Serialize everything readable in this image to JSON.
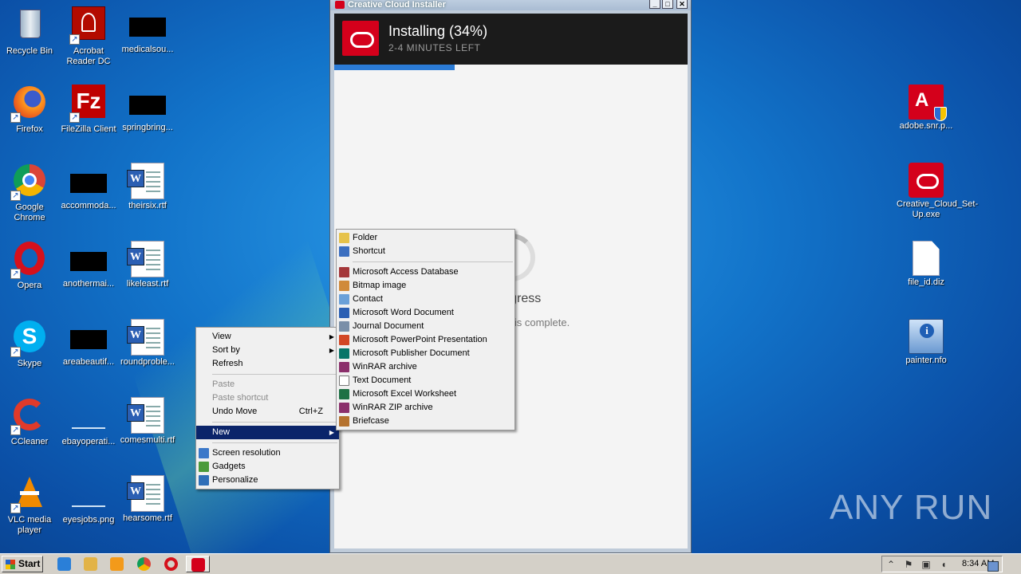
{
  "desktop_icons_left": [
    {
      "label": "Recycle Bin",
      "icon": "recycle-bin-icon"
    },
    {
      "label": "Acrobat Reader DC",
      "icon": "acrobat-icon"
    },
    {
      "label": "medicalsou...",
      "icon": "redacted-icon"
    },
    {
      "label": "Firefox",
      "icon": "firefox-icon"
    },
    {
      "label": "FileZilla Client",
      "icon": "filezilla-icon"
    },
    {
      "label": "springbring...",
      "icon": "redacted-icon"
    },
    {
      "label": "Google Chrome",
      "icon": "chrome-icon"
    },
    {
      "label": "accommoda...",
      "icon": "redacted-icon"
    },
    {
      "label": "theirsix.rtf",
      "icon": "word-doc-icon"
    },
    {
      "label": "Opera",
      "icon": "opera-icon"
    },
    {
      "label": "anothermai...",
      "icon": "redacted-icon"
    },
    {
      "label": "likeleast.rtf",
      "icon": "word-doc-icon"
    },
    {
      "label": "Skype",
      "icon": "skype-icon"
    },
    {
      "label": "areabeautif...",
      "icon": "redacted-icon"
    },
    {
      "label": "roundproble...",
      "icon": "word-doc-icon"
    },
    {
      "label": "CCleaner",
      "icon": "ccleaner-icon"
    },
    {
      "label": "ebayoperati...",
      "icon": "blank-icon"
    },
    {
      "label": "comesmulti.rtf",
      "icon": "word-doc-icon"
    },
    {
      "label": "VLC media player",
      "icon": "vlc-icon"
    },
    {
      "label": "eyesjobs.png",
      "icon": "image-icon"
    },
    {
      "label": "hearsome.rtf",
      "icon": "word-doc-icon"
    }
  ],
  "desktop_icons_right": [
    {
      "label": "adobe.snr.p...",
      "icon": "adobe-installer-icon"
    },
    {
      "label": "Creative_Cloud_Set-Up.exe",
      "icon": "creative-cloud-icon"
    },
    {
      "label": "file_id.diz",
      "icon": "blank-file-icon"
    },
    {
      "label": "painter.nfo",
      "icon": "info-file-icon"
    }
  ],
  "installer": {
    "window_title": "Creative Cloud Installer",
    "status_title": "Installing (34%)",
    "status_subtitle": "2-4 MINUTES LEFT",
    "progress_fraction": 0.34,
    "body_title": "n progress",
    "body_subtitle": "til installation is complete."
  },
  "context_menu": {
    "items": [
      {
        "label": "View",
        "submenu": true
      },
      {
        "label": "Sort by",
        "submenu": true
      },
      {
        "label": "Refresh"
      },
      {
        "label": "Paste",
        "disabled": true
      },
      {
        "label": "Paste shortcut",
        "disabled": true
      },
      {
        "label": "Undo Move",
        "shortcut": "Ctrl+Z"
      },
      {
        "label": "New",
        "submenu": true,
        "active": true
      },
      {
        "label": "Screen resolution"
      },
      {
        "label": "Gadgets"
      },
      {
        "label": "Personalize"
      }
    ]
  },
  "new_submenu": {
    "items": [
      {
        "label": "Folder",
        "color": "#e6c24a"
      },
      {
        "label": "Shortcut",
        "color": "#3b6fc0"
      },
      {
        "label": "Microsoft Access Database",
        "color": "#a4373a"
      },
      {
        "label": "Bitmap image",
        "color": "#d08a3a"
      },
      {
        "label": "Contact",
        "color": "#6aa0d8"
      },
      {
        "label": "Microsoft Word Document",
        "color": "#2b5fb3"
      },
      {
        "label": "Journal Document",
        "color": "#7a8fa8"
      },
      {
        "label": "Microsoft PowerPoint Presentation",
        "color": "#d24726"
      },
      {
        "label": "Microsoft Publisher Document",
        "color": "#077568"
      },
      {
        "label": "WinRAR archive",
        "color": "#8b2f6b"
      },
      {
        "label": "Text Document",
        "color": "#ffffff"
      },
      {
        "label": "Microsoft Excel Worksheet",
        "color": "#1e7145"
      },
      {
        "label": "WinRAR ZIP archive",
        "color": "#8b2f6b"
      },
      {
        "label": "Briefcase",
        "color": "#b5722e"
      }
    ]
  },
  "watermark": "ANY RUN",
  "taskbar": {
    "start_label": "Start",
    "clock": "8:34 AM"
  }
}
